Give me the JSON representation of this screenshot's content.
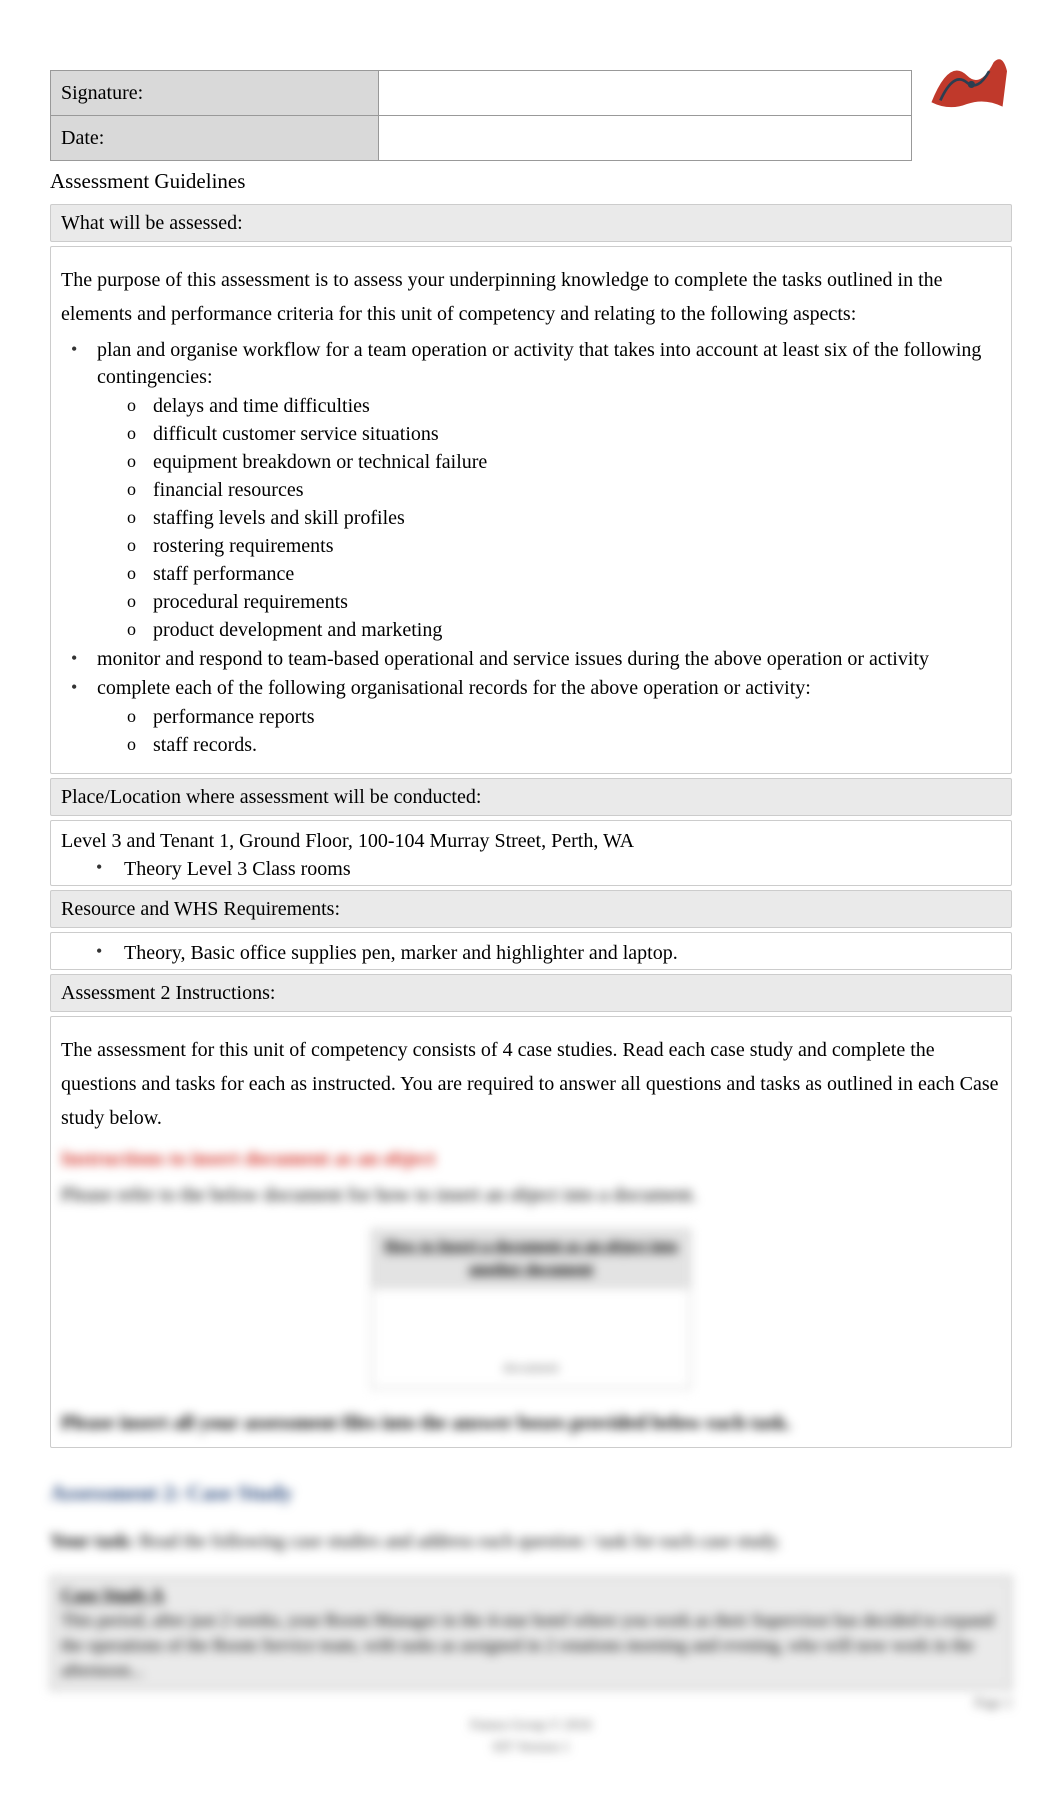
{
  "header": {
    "signature_label": "Signature:",
    "signature_value": "",
    "date_label": "Date:",
    "date_value": ""
  },
  "title": "Assessment Guidelines",
  "sections": {
    "what_assessed_heading": "What will be assessed:",
    "purpose_para": "The purpose of this assessment is to assess your underpinning knowledge to complete the tasks outlined in the elements and performance criteria for this unit of competency and relating to the following aspects:",
    "bullets": {
      "b1": "plan and organise workflow for a team operation or activity that takes into account at least six of the following contingencies:",
      "b1_subs": [
        "delays and time difficulties",
        "difficult customer service situations",
        "equipment breakdown or technical failure",
        "financial resources",
        "staffing levels and skill profiles",
        "rostering requirements",
        "staff performance",
        "procedural requirements",
        "product development and marketing"
      ],
      "b2": "monitor and respond to team-based operational and service issues during the above operation or activity",
      "b3": "complete each of the following organisational records for the above operation or activity:",
      "b3_subs": [
        "performance reports",
        "staff records."
      ]
    },
    "place_heading": "Place/Location where assessment will be conducted:",
    "place_text": "Level 3 and Tenant 1, Ground Floor, 100-104 Murray Street, Perth, WA",
    "place_bullet": "Theory Level 3 Class rooms",
    "resource_heading": "Resource and WHS Requirements:",
    "resource_bullet": "Theory, Basic office supplies pen, marker and highlighter and laptop.",
    "instructions_heading": "Assessment 2 Instructions:",
    "instructions_para": "The assessment for this unit of competency consists of 4 case studies. Read each case study and complete the questions and tasks for each as instructed. You are required to answer all questions and tasks as outlined in each Case study below."
  },
  "blurred": {
    "red_line": "Instructions to insert document as an object",
    "refer_line": "Please refer to the below document for how to insert an object into a document.",
    "embed_title": "How to Insert a document as an object into another document",
    "embed_footer": "document",
    "insert_line": "Please insert all your assessment files into the answer boxes provided below each task.",
    "assessment_heading": "Assessment 2: Case Study",
    "task_label": "Your task:",
    "task_text": " Read the following case studies and address each question / task for each case study.",
    "case_title": "Case Study A",
    "case_body": "This period, after just 2 weeks, your Room Manager in the 4-star hotel where you work as their Supervisor has decided to expand the operations of the Room Service team, with tasks as assigned in 2 rotations morning and evening, who will now work in the afternoon...",
    "page_label": "Page 2",
    "footer1": "Futura Group © 2016",
    "footer2": "SIT Version 1"
  }
}
